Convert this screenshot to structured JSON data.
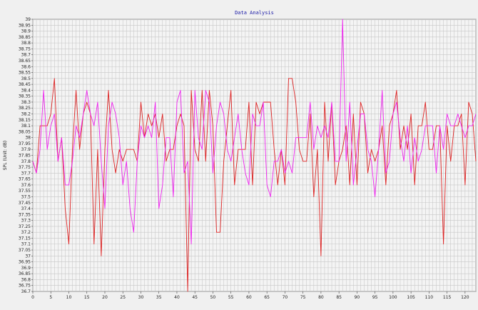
{
  "chart_data": {
    "type": "line",
    "title": "Data Analysis",
    "xlabel": "",
    "ylabel": "SPL (Unit: dB)",
    "xlim": [
      0,
      123
    ],
    "ylim": [
      36.7,
      39
    ],
    "xticks": [
      0,
      5,
      10,
      15,
      20,
      25,
      30,
      35,
      40,
      45,
      50,
      55,
      60,
      65,
      70,
      75,
      80,
      85,
      90,
      95,
      100,
      105,
      110,
      115,
      120
    ],
    "yticks": [
      36.7,
      36.75,
      36.8,
      36.85,
      36.9,
      36.95,
      37,
      37.05,
      37.1,
      37.15,
      37.2,
      37.25,
      37.3,
      37.35,
      37.4,
      37.45,
      37.5,
      37.55,
      37.6,
      37.65,
      37.7,
      37.75,
      37.8,
      37.85,
      37.9,
      37.95,
      38,
      38.05,
      38.1,
      38.15,
      38.2,
      38.25,
      38.3,
      38.35,
      38.4,
      38.45,
      38.5,
      38.55,
      38.6,
      38.65,
      38.7,
      38.75,
      38.8,
      38.85,
      38.9,
      38.95,
      39
    ],
    "grid": true,
    "legend": "none",
    "colors": [
      "#dd2222",
      "#ee22ee"
    ],
    "series": [
      {
        "x": [
          0,
          1,
          2,
          3,
          4,
          5,
          6,
          7,
          8,
          9,
          10,
          11,
          12,
          13,
          14,
          15,
          16,
          17,
          18,
          19,
          20,
          21,
          22,
          23,
          24,
          25,
          26,
          27,
          28,
          29,
          30,
          31,
          32,
          33,
          34,
          35,
          36,
          37,
          38,
          39,
          40,
          41,
          42,
          43,
          44,
          45,
          46,
          47,
          48,
          49,
          50,
          51,
          52,
          53,
          54,
          55,
          56,
          57,
          58,
          59,
          60,
          61,
          62,
          63,
          64,
          65,
          66,
          67,
          68,
          69,
          70,
          71,
          72,
          73,
          74,
          75,
          76,
          77,
          78,
          79,
          80,
          81,
          82,
          83,
          84,
          85,
          86,
          87,
          88,
          89,
          90,
          91,
          92,
          93,
          94,
          95,
          96,
          97,
          98,
          99,
          100,
          101,
          102,
          103,
          104,
          105,
          106,
          107,
          108,
          109,
          110,
          111,
          112,
          113,
          114,
          115,
          116,
          117,
          118,
          119,
          120,
          121,
          122,
          123
        ],
        "values": [
          37.8,
          37.7,
          38.1,
          38.1,
          38.1,
          38.2,
          38.5,
          37.8,
          38,
          37.4,
          37.1,
          37.9,
          38.4,
          37.9,
          38.2,
          38.3,
          38.2,
          37.1,
          37.9,
          37,
          37.9,
          38.4,
          37.9,
          37.7,
          37.9,
          37.8,
          37.9,
          37.9,
          37.9,
          37.8,
          38.3,
          38,
          38.2,
          38.1,
          38.2,
          38,
          38.2,
          37.8,
          37.9,
          37.9,
          38.1,
          38.2,
          38.1,
          36.7,
          38.4,
          37.9,
          37.8,
          38.4,
          37.8,
          38.4,
          38.1,
          37.2,
          37.2,
          37.8,
          38.1,
          38.4,
          37.6,
          37.9,
          37.9,
          37.9,
          38.3,
          37.6,
          38.3,
          38.2,
          38.3,
          38.3,
          38.3,
          37.9,
          37.6,
          37.9,
          37.6,
          38.5,
          38.5,
          38.3,
          37.9,
          37.8,
          37.8,
          38.2,
          37.5,
          37.9,
          37,
          38.3,
          37.8,
          38.3,
          37.6,
          37.8,
          37.9,
          38.1,
          37.6,
          38.2,
          37.6,
          38.3,
          38.2,
          37.7,
          37.9,
          37.8,
          37.9,
          38.1,
          37.6,
          38.1,
          38.2,
          38.4,
          37.9,
          38.1,
          37.9,
          38.2,
          37.6,
          38.1,
          38.1,
          38.3,
          37.9,
          37.9,
          38.1,
          38.1,
          37.1,
          38.1,
          37.8,
          38.1,
          38.1,
          38.2,
          37.6,
          38.3,
          38.2,
          37.8
        ]
      },
      {
        "x": [
          0,
          1,
          2,
          3,
          4,
          5,
          6,
          7,
          8,
          9,
          10,
          11,
          12,
          13,
          14,
          15,
          16,
          17,
          18,
          19,
          20,
          21,
          22,
          23,
          24,
          25,
          26,
          27,
          28,
          29,
          30,
          31,
          32,
          33,
          34,
          35,
          36,
          37,
          38,
          39,
          40,
          41,
          42,
          43,
          44,
          45,
          46,
          47,
          48,
          49,
          50,
          51,
          52,
          53,
          54,
          55,
          56,
          57,
          58,
          59,
          60,
          61,
          62,
          63,
          64,
          65,
          66,
          67,
          68,
          69,
          70,
          71,
          72,
          73,
          74,
          75,
          76,
          77,
          78,
          79,
          80,
          81,
          82,
          83,
          84,
          85,
          86,
          87,
          88,
          89,
          90,
          91,
          92,
          93,
          94,
          95,
          96,
          97,
          98,
          99,
          100,
          101,
          102,
          103,
          104,
          105,
          106,
          107,
          108,
          109,
          110,
          111,
          112,
          113,
          114,
          115,
          116,
          117,
          118,
          119,
          120,
          121,
          122,
          123
        ],
        "values": [
          37.8,
          37.7,
          37.9,
          38.4,
          37.9,
          38.1,
          38.2,
          37.8,
          38,
          37.6,
          37.6,
          37.8,
          38.1,
          38,
          38.2,
          38.4,
          38.2,
          38.1,
          38.3,
          37.8,
          37.4,
          38.1,
          38.3,
          38.2,
          38,
          37.6,
          37.8,
          37.4,
          37.2,
          37.8,
          38.1,
          38,
          38.1,
          38,
          38.3,
          37.4,
          37.6,
          38,
          38,
          37.5,
          38.3,
          38.4,
          37.7,
          37.8,
          37.1,
          38.4,
          38,
          37.9,
          38.4,
          38.3,
          37.7,
          38.1,
          38.3,
          38.2,
          37.9,
          37.8,
          38,
          38.2,
          37.9,
          37.7,
          37.6,
          38.2,
          38.1,
          38.1,
          38.3,
          37.6,
          37.5,
          37.8,
          37.8,
          37.9,
          37.7,
          37.8,
          37.7,
          38,
          38,
          38,
          38,
          38.3,
          37.9,
          38.1,
          38,
          38.1,
          38,
          38.3,
          37.8,
          37.8,
          39,
          37.8,
          38.3,
          37.6,
          37.9,
          38.2,
          38.2,
          37.9,
          37.8,
          37.5,
          37.9,
          38.4,
          37.7,
          37.8,
          38.2,
          38.3,
          38,
          37.8,
          38.1,
          37.7,
          38,
          37.8,
          37.9,
          38.1,
          38.1,
          38.1,
          37.7,
          38.1,
          37.9,
          38.2,
          38.1,
          38.1,
          38.2,
          38.1,
          38,
          38.1,
          38.1,
          38.2
        ]
      }
    ]
  }
}
